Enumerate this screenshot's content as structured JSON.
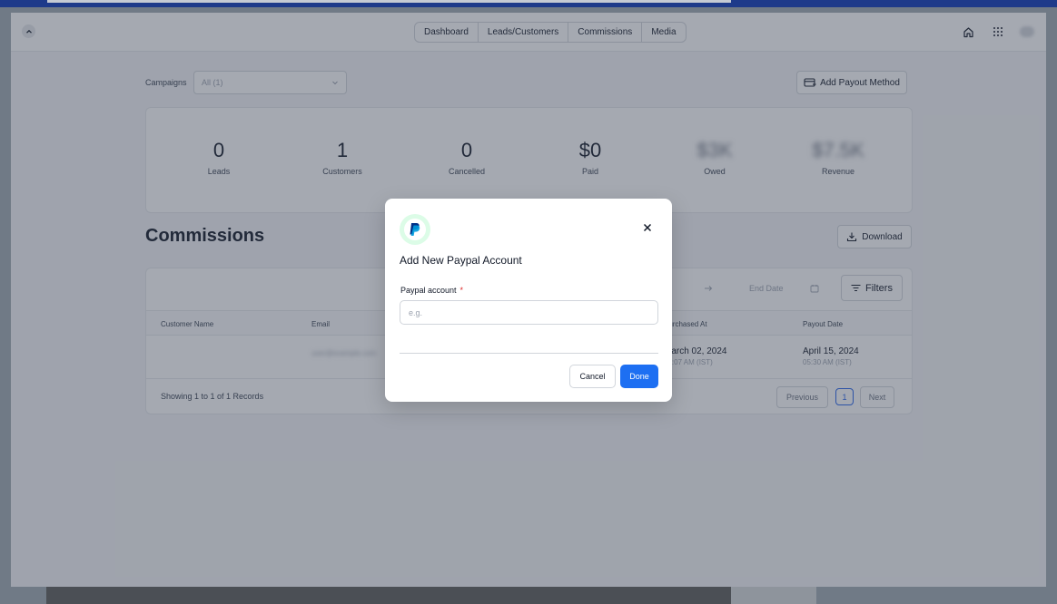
{
  "nav": {
    "tabs": [
      "Dashboard",
      "Leads/Customers",
      "Commissions",
      "Media"
    ]
  },
  "campaigns": {
    "label": "Campaigns",
    "selected": "All (1)"
  },
  "add_payout_label": "Add Payout Method",
  "stats": [
    {
      "value": "0",
      "label": "Leads"
    },
    {
      "value": "1",
      "label": "Customers"
    },
    {
      "value": "0",
      "label": "Cancelled"
    },
    {
      "value": "$0",
      "label": "Paid"
    },
    {
      "value": "$3K",
      "label": "Owed"
    },
    {
      "value": "$7.5K",
      "label": "Revenue"
    }
  ],
  "commissions": {
    "title": "Commissions",
    "download_label": "Download",
    "end_date_placeholder": "End Date",
    "filters_label": "Filters",
    "columns": [
      "Customer Name",
      "Email",
      "Purchased At",
      "Payout Date"
    ],
    "row": {
      "email": "user@example.com",
      "purchased_date": "March 02, 2024",
      "purchased_time": "10:07 AM (IST)",
      "payout_date": "April 15, 2024",
      "payout_time": "05:30 AM (IST)"
    },
    "records_text": "Showing 1 to 1 of 1 Records",
    "pagination": {
      "previous": "Previous",
      "current": "1",
      "next": "Next"
    }
  },
  "modal": {
    "title": "Add New Paypal Account",
    "field_label": "Paypal account",
    "required_mark": "*",
    "placeholder": "e.g.",
    "value": "",
    "cancel_label": "Cancel",
    "done_label": "Done"
  },
  "colors": {
    "accent": "#1d6ff2",
    "required": "#dc2626",
    "paypal_dark": "#003087",
    "paypal_light": "#009cde",
    "logo_bg": "#dcfce7"
  },
  "icons": [
    "chevron-up-icon",
    "home-icon",
    "apps-grid-icon",
    "card-icon",
    "chevron-down-icon",
    "download-icon",
    "arrow-right-icon",
    "calendar-icon",
    "filter-icon",
    "paypal-logo-icon",
    "close-icon"
  ]
}
